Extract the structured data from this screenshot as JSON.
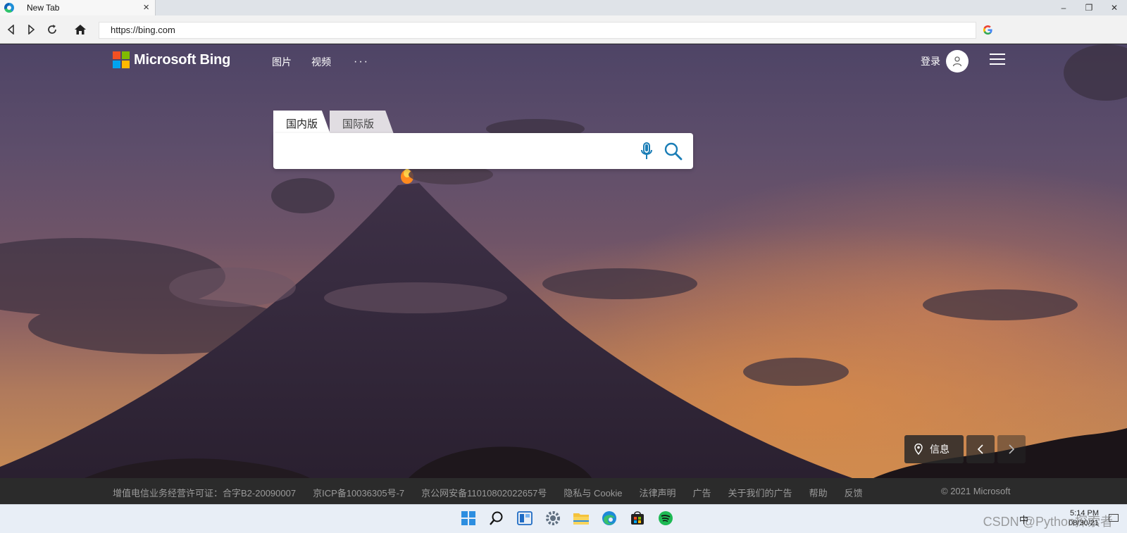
{
  "browser": {
    "tab_title": "New Tab",
    "tab_close": "×",
    "window_controls": [
      "–",
      "❐",
      "✕"
    ],
    "url": "https://bing.com"
  },
  "bing": {
    "logo_text": "Microsoft Bing",
    "nav": [
      "图片",
      "视频"
    ],
    "more": "···",
    "login": "登录",
    "search_tabs": {
      "domestic": "国内版",
      "international": "国际版"
    },
    "search_placeholder": "",
    "info_label": "信息"
  },
  "footer": {
    "links": [
      "增值电信业务经营许可证：合字B2-20090007",
      "京ICP备10036305号-7",
      "京公网安备11010802022657号",
      "隐私与 Cookie",
      "法律声明",
      "广告",
      "关于我们的广告",
      "帮助",
      "反馈"
    ],
    "copyright": "© 2021 Microsoft"
  },
  "taskbar": {
    "icons": [
      "start-icon",
      "search-icon",
      "widgets-icon",
      "settings-icon",
      "file-explorer-icon",
      "edge-icon",
      "store-icon",
      "spotify-icon"
    ],
    "watermark": "CSDN @Python探索者",
    "ime": "中",
    "time": "5:14 PM",
    "date": "08/30/21"
  },
  "colors": {
    "accent": "#1a7db6",
    "footer_bg": "#2b2b2b",
    "footer_text": "#9a9a9a"
  }
}
